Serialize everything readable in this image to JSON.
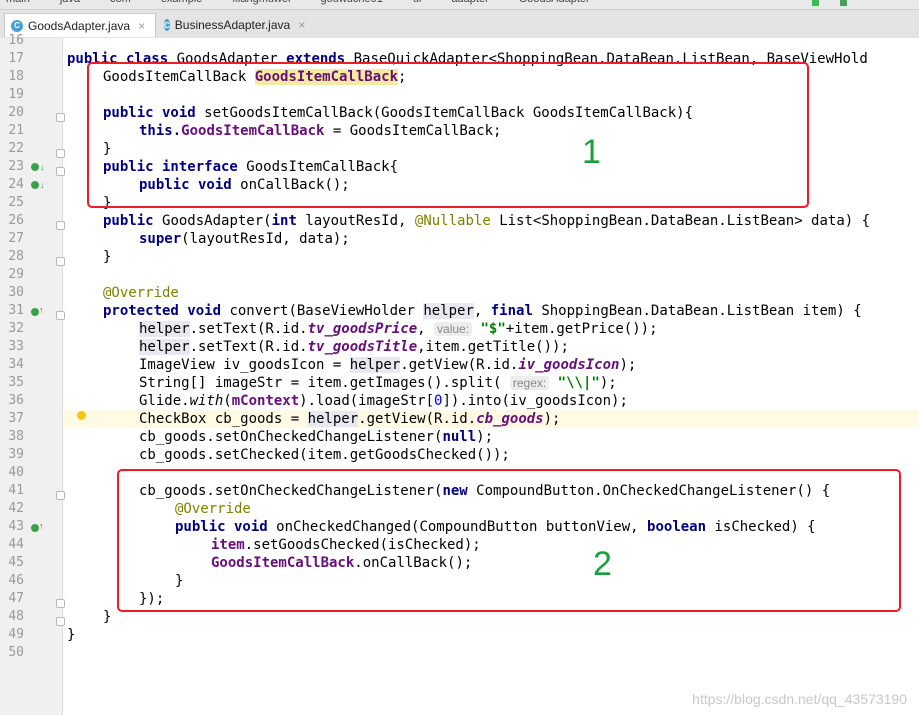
{
  "breadcrumb": [
    "main",
    "java",
    "com",
    "example",
    "xiangmuwei",
    "gouwuche01",
    "ui",
    "adapter",
    "GoodsAdapter"
  ],
  "toolbar": {
    "run_config": "gouwuche01"
  },
  "tabs": [
    {
      "label": "GoodsAdapter.java",
      "icon": "class-icon",
      "icon_glyph": "C",
      "active": true,
      "close": "×"
    },
    {
      "label": "BusinessAdapter.java",
      "icon": "class-icon",
      "icon_glyph": "C",
      "active": false,
      "close": "×"
    }
  ],
  "line_numbers": [
    "16",
    "17",
    "18",
    "19",
    "20",
    "21",
    "22",
    "23",
    "24",
    "25",
    "26",
    "27",
    "28",
    "29",
    "30",
    "31",
    "32",
    "33",
    "34",
    "35",
    "36",
    "37",
    "38",
    "39",
    "40",
    "41",
    "42",
    "43",
    "44",
    "45",
    "46",
    "47",
    "48",
    "49",
    "50"
  ],
  "code": {
    "l17": {
      "kw1": "public class ",
      "name": "GoodsAdapter ",
      "kw2": "extends ",
      "rest": "BaseQuickAdapter<ShoppingBean.DataBean.ListBean, BaseViewHold"
    },
    "l18": {
      "type": "GoodsItemCallBack ",
      "field": "GoodsItemCallBack",
      ";": ";"
    },
    "l20": {
      "kw": "public void ",
      "rest": "setGoodsItemCallBack(GoodsItemCallBack GoodsItemCallBack){"
    },
    "l21": {
      "kw": "this.",
      "field": "GoodsItemCallBack",
      "rest": " = GoodsItemCallBack;"
    },
    "l22": "}",
    "l23": {
      "kw": "public interface ",
      "rest": "GoodsItemCallBack{"
    },
    "l24": {
      "kw": "public void ",
      "rest": "onCallBack();"
    },
    "l25": "}",
    "l26": {
      "kw": "public ",
      "a": "GoodsAdapter(",
      "kw2": "int ",
      "b": "layoutResId, ",
      "anno": "@Nullable ",
      "c": "List<ShoppingBean.DataBean.ListBean> data) {"
    },
    "l27": {
      "kw": "super",
      "rest": "(layoutResId, data);"
    },
    "l28": "}",
    "l30": "@Override",
    "l31": {
      "kw": "protected void ",
      "a": "convert(BaseViewHolder ",
      "p": "helper",
      ", ": ", ",
      "kw2": "final ",
      "b": "ShoppingBean.DataBean.ListBean item) {"
    },
    "l32": {
      "p": "helper",
      ".setText(R.id.": ".setText(R.id.",
      "f": "tv_goodsPrice",
      ",": ", ",
      "hint": "value:",
      "str": "\"$\"",
      "rest": "+item.getPrice());"
    },
    "l33": {
      "p": "helper",
      "a": ".setText(R.id.",
      "f": "tv_goodsTitle",
      "rest": ",item.getTitle());"
    },
    "l34": {
      "a": "ImageView iv_goodsIcon = ",
      "p": "helper",
      "b": ".getView(R.id.",
      "f": "iv_goodsIcon",
      "rest": ");"
    },
    "l35": {
      "a": "String[] imageStr = item.getImages().split( ",
      "hint": "regex:",
      "str": "\"\\\\|\"",
      "rest": ");"
    },
    "l36": {
      "a": "Glide.",
      "i": "with",
      "b": "(",
      "f": "mContext",
      "c": ").load(imageStr[",
      "n": "0",
      "rest": "]).into(iv_goodsIcon);"
    },
    "l37": {
      "a": "CheckBox cb_goods = ",
      "p": "helper",
      "b": ".getView(R.id.",
      "f": "cb_goods",
      "rest": ");"
    },
    "l38": {
      "a": "cb_goods.setOnCheckedChangeListener(",
      "kw": "null",
      "rest": ");"
    },
    "l39": "cb_goods.setChecked(item.getGoodsChecked());",
    "l41": {
      "a": "cb_goods.setOnCheckedChangeListener(",
      "kw": "new ",
      "rest": "CompoundButton.OnCheckedChangeListener() {"
    },
    "l42": "@Override",
    "l43": {
      "kw": "public void ",
      "a": "onCheckedChanged(CompoundButton buttonView, ",
      "kw2": "boolean ",
      "rest": "isChecked) {"
    },
    "l44": {
      "f": "item",
      "rest": ".setGoodsChecked(isChecked);"
    },
    "l45": {
      "f": "GoodsItemCallBack",
      "rest": ".onCallBack();"
    },
    "l46": "}",
    "l47": "});",
    "l48": "}",
    "l49": "}"
  },
  "annotations": {
    "box1_label": "1",
    "box2_label": "2",
    "box_color": "#ee1c25",
    "label_color": "#1a9f3a"
  },
  "watermark": "https://blog.csdn.net/qq_43573190",
  "colors": {
    "keyword": "#000080",
    "field": "#660e7a",
    "annotation": "#808000",
    "string": "#008000"
  }
}
